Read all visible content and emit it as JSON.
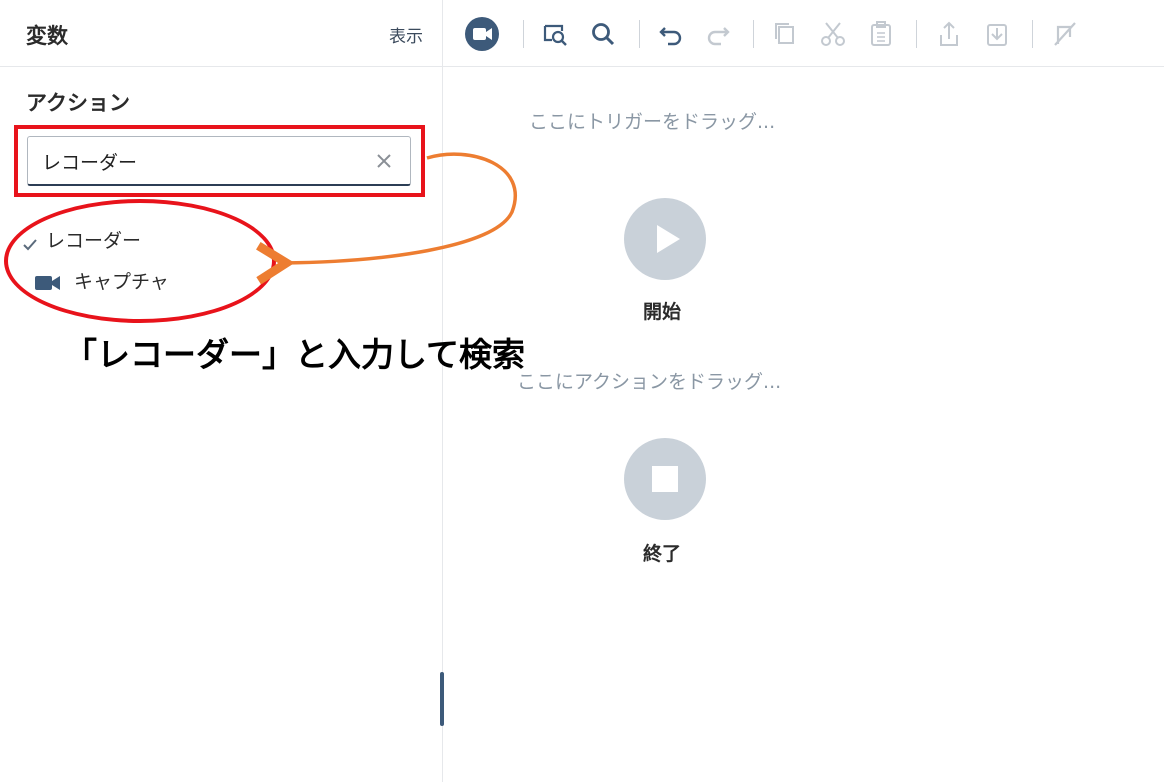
{
  "left_panel": {
    "title": "変数",
    "view_label": "表示",
    "actions_heading": "アクション",
    "search": {
      "value": "レコーダー",
      "placeholder": ""
    },
    "tree": [
      {
        "label": "レコーダー",
        "icon": "check-icon"
      },
      {
        "label": "キャプチャ",
        "icon": "camera-icon"
      }
    ]
  },
  "annotation": {
    "text": "「レコーダー」と入力して検索",
    "color": "#e8131b",
    "arrow_color": "#ed7d31"
  },
  "toolbar": {
    "icons": [
      "record-icon",
      "find-element-icon",
      "search-icon",
      "undo-icon",
      "redo-icon",
      "copy-icon",
      "cut-icon",
      "paste-icon",
      "export-icon",
      "import-icon",
      "disable-icon"
    ]
  },
  "canvas": {
    "trigger_hint": "ここにトリガーをドラッグ...",
    "action_hint": "ここにアクションをドラッグ...",
    "start_label": "開始",
    "end_label": "終了"
  },
  "colors": {
    "accent": "#2c4a6e",
    "node": "#c9d1d9",
    "hint": "#8a97a4"
  }
}
